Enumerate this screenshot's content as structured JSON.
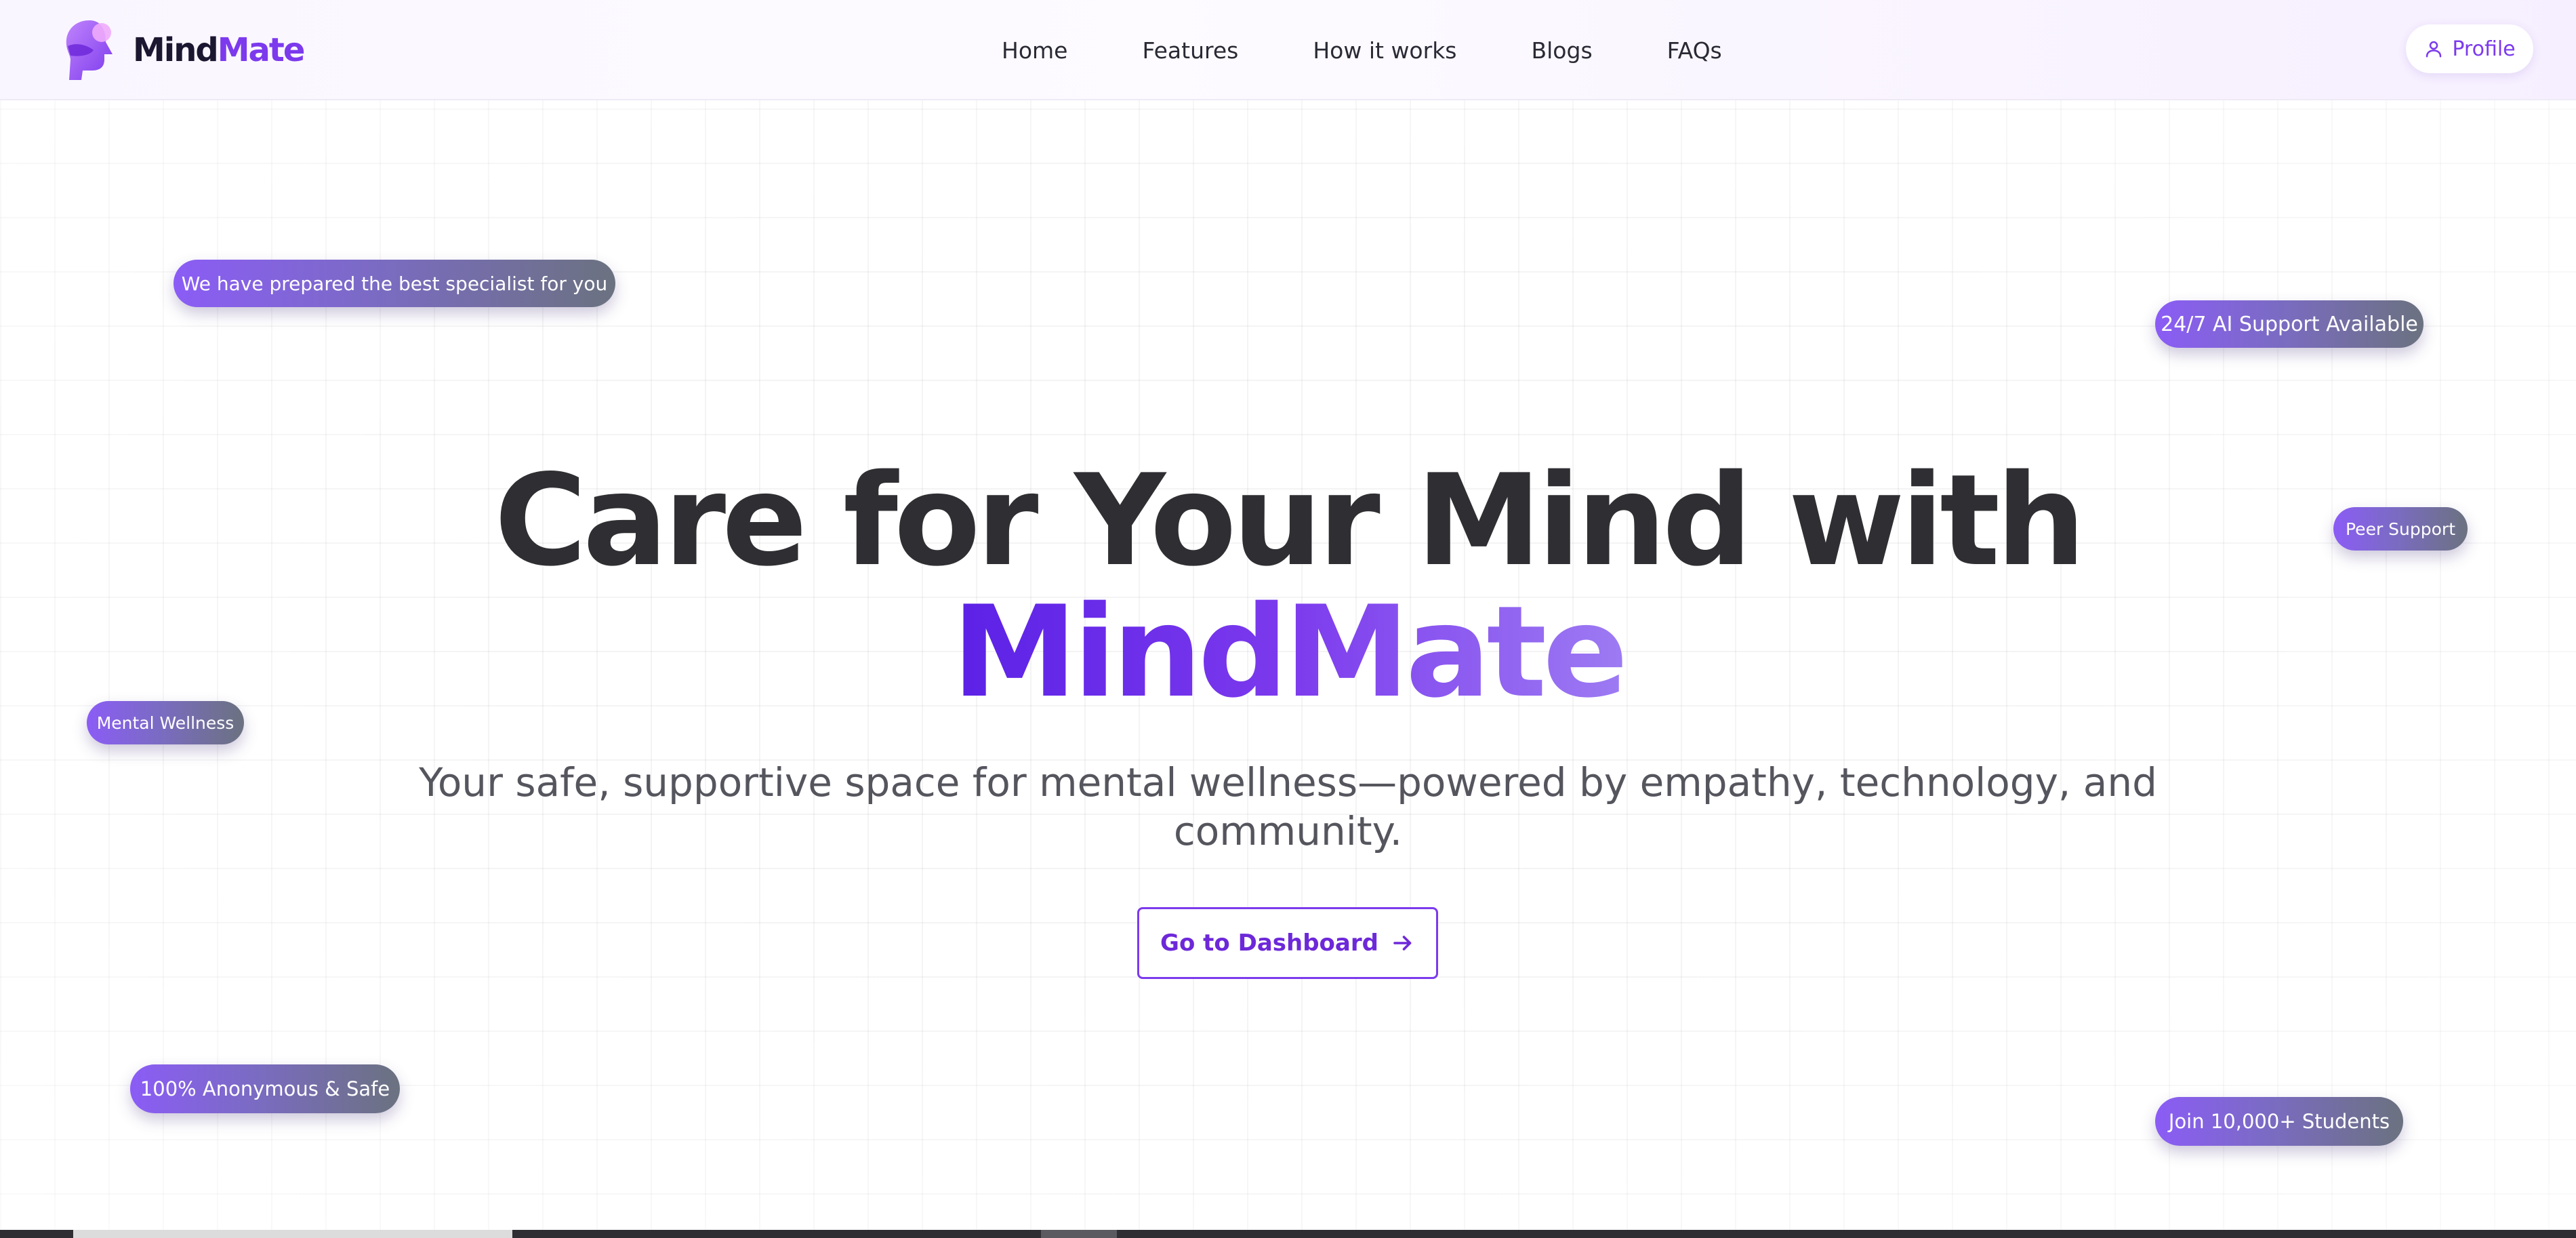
{
  "brand": {
    "name_part1": "Mind",
    "name_part2": "Mate",
    "primary_color": "#7c3aed"
  },
  "nav": {
    "items": [
      {
        "label": "Home"
      },
      {
        "label": "Features"
      },
      {
        "label": "How it works"
      },
      {
        "label": "Blogs"
      },
      {
        "label": "FAQs"
      }
    ],
    "profile": {
      "label": "Profile",
      "icon": "user-icon"
    }
  },
  "pills": {
    "specialist": "We have prepared the best specialist for you",
    "ai_support": "24/7 AI Support Available",
    "peer_support": "Peer Support",
    "mental_wellness": "Mental Wellness",
    "anonymous": "100% Anonymous & Safe",
    "students": "Join 10,000+ Students"
  },
  "hero": {
    "title_line1": "Care for Your Mind with",
    "title_brand": "MindMate",
    "subtitle": "Your safe, supportive space for mental wellness—powered by empathy, technology, and community.",
    "cta_label": "Go to Dashboard",
    "cta_icon": "arrow-right-icon"
  }
}
